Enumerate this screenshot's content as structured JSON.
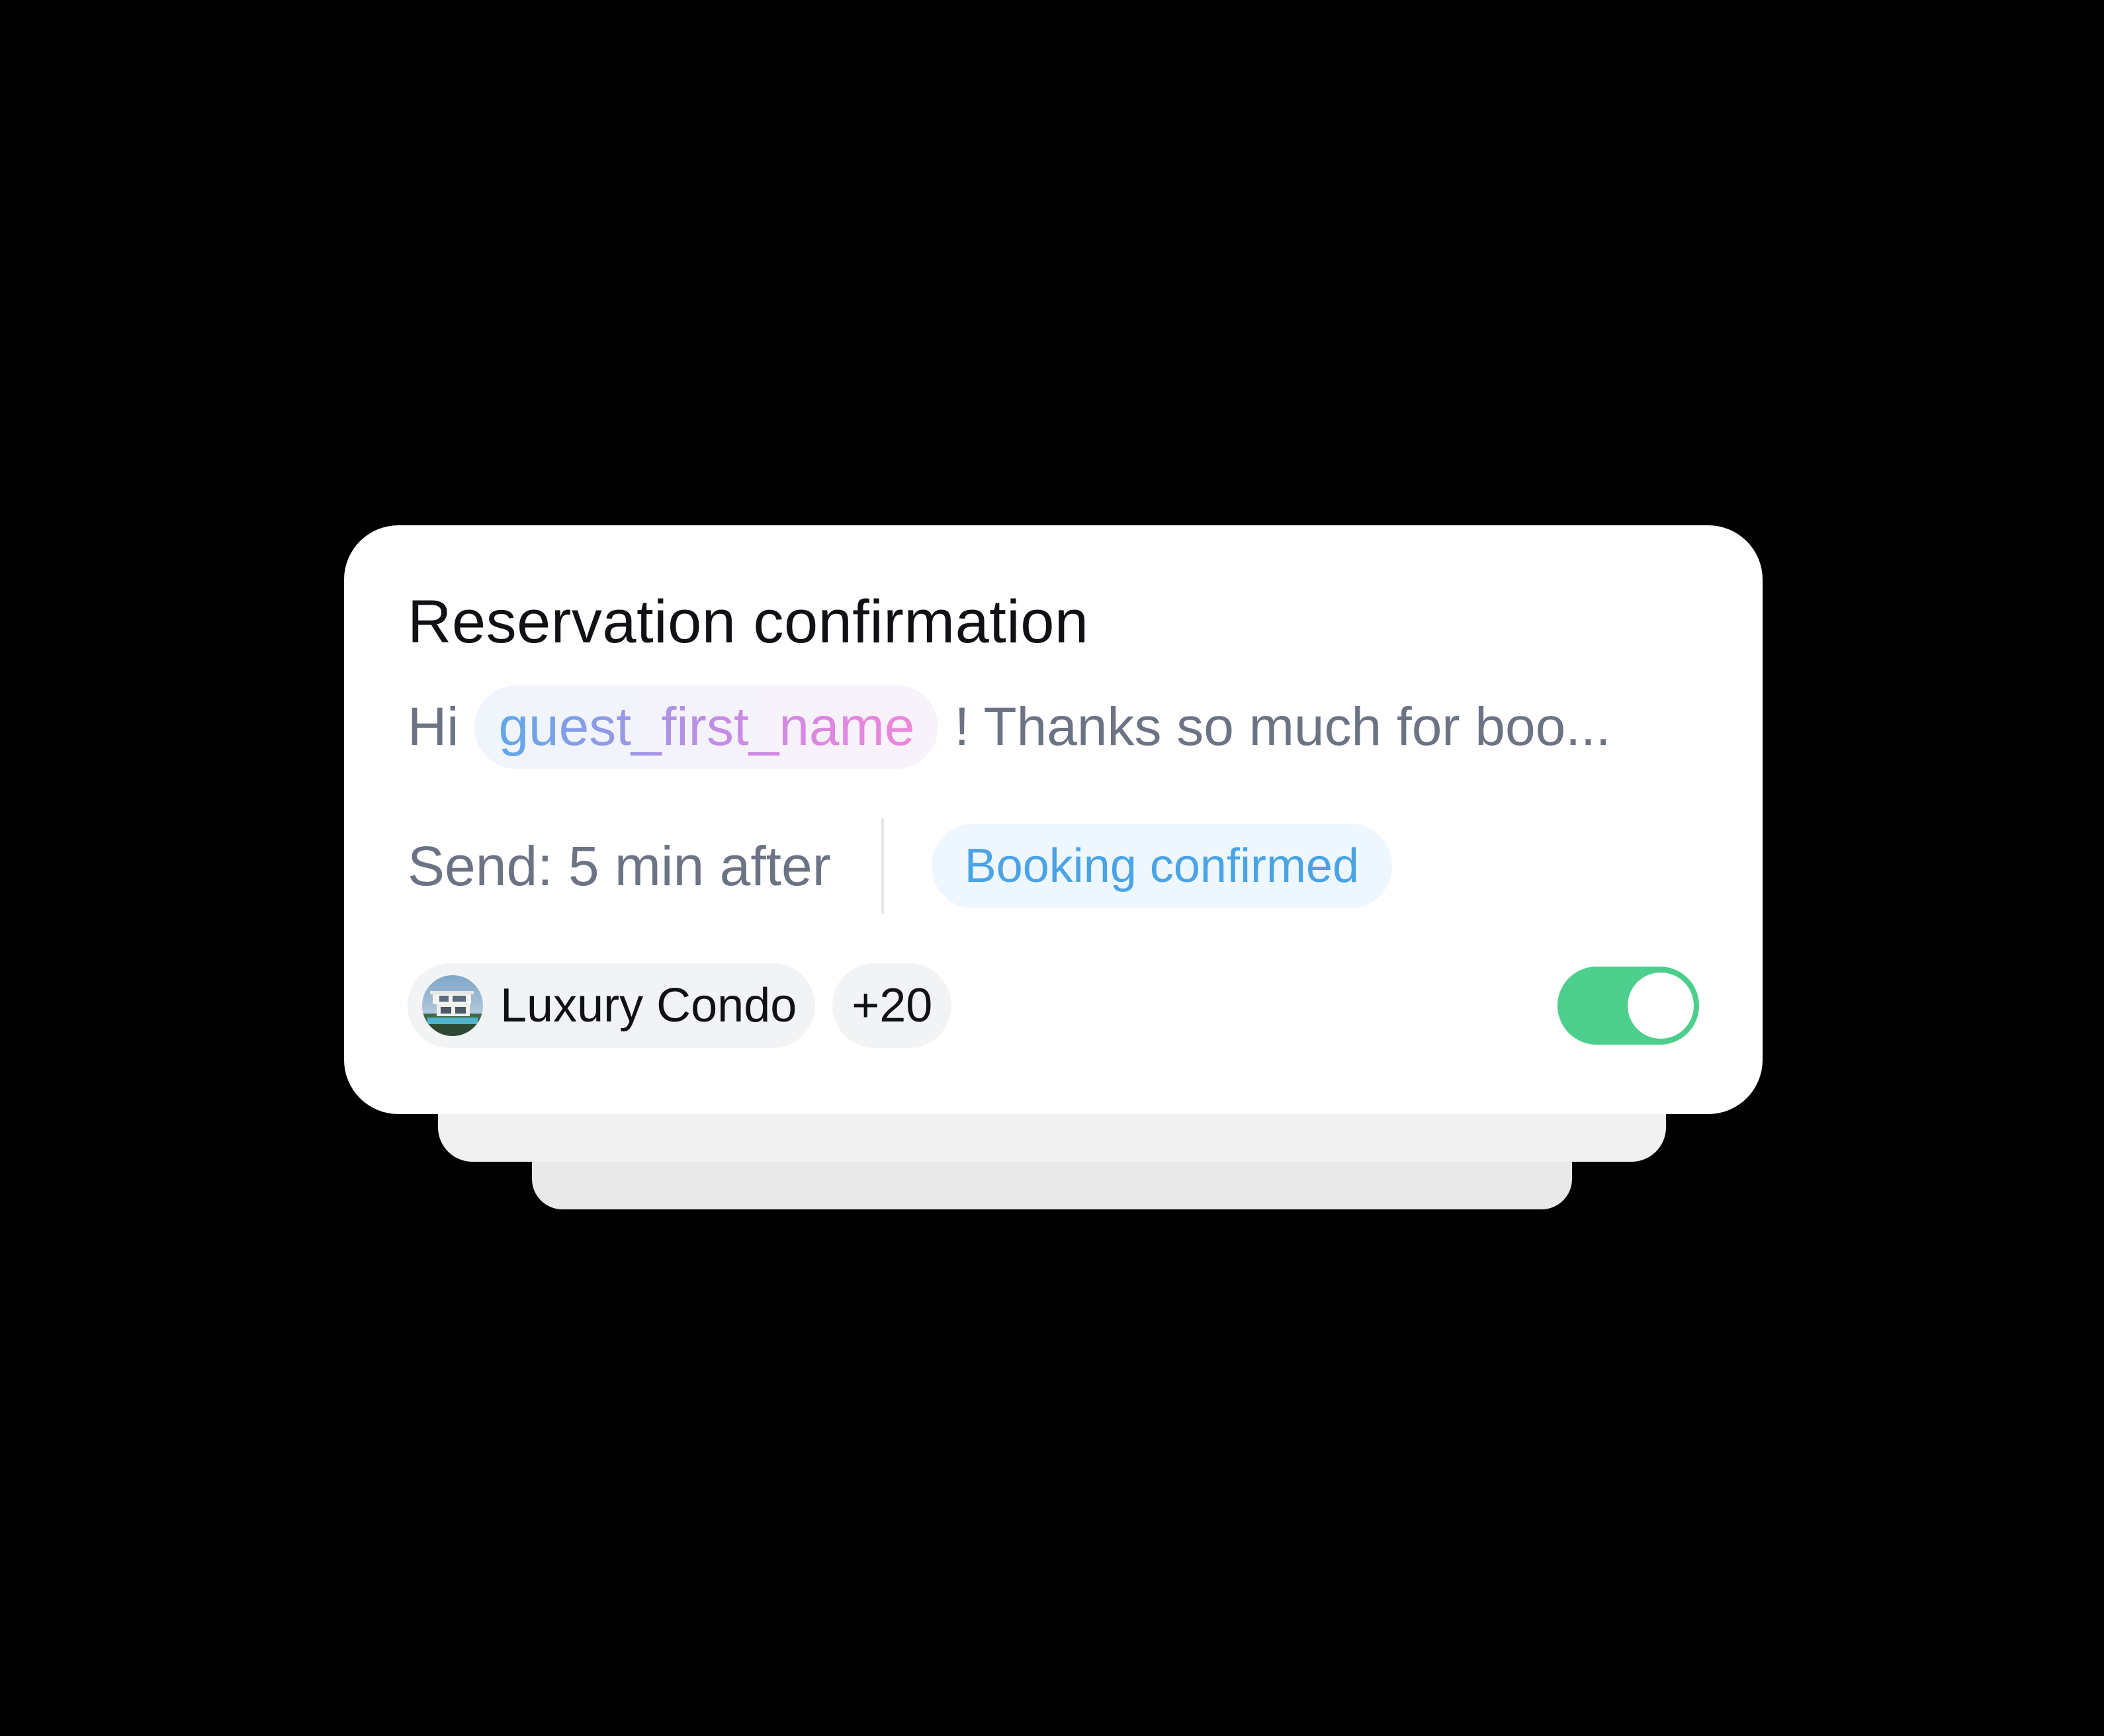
{
  "card": {
    "title": "Reservation confirmation",
    "preview": {
      "greeting": "Hi",
      "variable": "guest_first_name",
      "rest": "! Thanks so much for boo..."
    },
    "send": {
      "label": "Send: 5 min after",
      "event": "Booking confirmed"
    },
    "property": {
      "name": "Luxury Condo",
      "avatar_icon": "house-photo",
      "more_count": "+20"
    },
    "enabled": true
  },
  "colors": {
    "background": "#000000",
    "card": "#ffffff",
    "event_pill_text": "#4aa3e6",
    "event_pill_bg": "#eef6fe",
    "toggle_on": "#4cce8d",
    "variable_gradient": [
      "#5fa8e8",
      "#ee86da"
    ],
    "muted_text": "#6b7384"
  }
}
